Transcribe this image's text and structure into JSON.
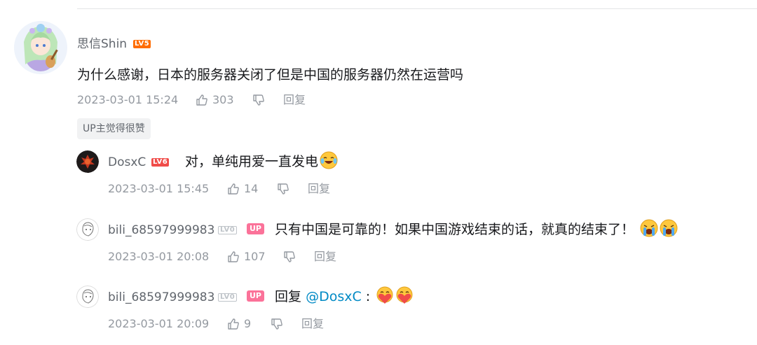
{
  "comment": {
    "username": "思信Shin",
    "level": "LV5",
    "text": "为什么感谢，日本的服务器关闭了但是中国的服务器仍然在运营吗",
    "time": "2023-03-01 15:24",
    "likes": "303",
    "reply_label": "回复",
    "tag": "UP主觉得很赞"
  },
  "replies": [
    {
      "username": "DosxC",
      "level": "LV6",
      "text": "对，单纯用爱一直发电",
      "emoji": "laughing-tears-emoji",
      "time": "2023-03-01 15:45",
      "likes": "14",
      "reply_label": "回复"
    },
    {
      "username": "bili_68597999983",
      "level": "LV0",
      "badge": "UP",
      "text": "只有中国是可靠的！如果中国游戏结束的话，就真的结束了！",
      "emoji": "crying-emoji",
      "time": "2023-03-01 20:08",
      "likes": "107",
      "reply_label": "回复"
    },
    {
      "username": "bili_68597999983",
      "level": "LV0",
      "badge": "UP",
      "reply_prefix": "回复",
      "mention": "@DosxC",
      "colon": ":",
      "emoji": "heart-hug-emoji",
      "time": "2023-03-01 20:09",
      "likes": "9",
      "reply_label": "回复"
    }
  ],
  "colors": {
    "lv5": "#ff6c00",
    "lv6": "#f04c49",
    "up_badge": "#fb7299",
    "mention": "#008ac5",
    "meta": "#9499a0"
  }
}
